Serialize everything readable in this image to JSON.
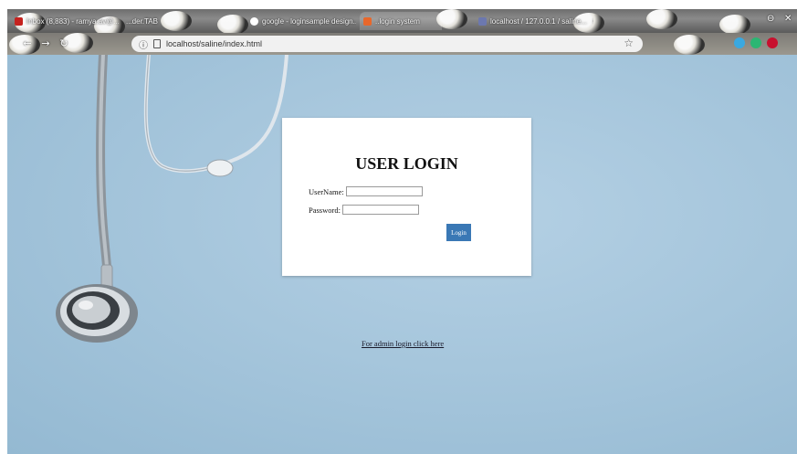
{
  "browser": {
    "tabs": [
      {
        "label": "Inbox (8,883) - ramya.av@..."
      },
      {
        "label": "...der.TAB"
      },
      {
        "label": "google - loginsample design..."
      },
      {
        "label": "..login system"
      },
      {
        "label": "localhost / 127.0.0.1 / saline..."
      }
    ],
    "window_controls": {
      "minimize": "⊖",
      "close": "✕"
    },
    "nav": {
      "back": "←",
      "forward": "→",
      "reload": "↻"
    },
    "url": "localhost/saline/index.html",
    "url_info_icon": "ⓘ",
    "bookmark_icon": "☆",
    "extension_colors": [
      "#3aa8e0",
      "#2bb673",
      "#c8102e"
    ]
  },
  "login": {
    "title": "USER LOGIN",
    "username_label": "UserName:",
    "username_value": "",
    "password_label": "Password:",
    "password_value": "",
    "button_label": "Login",
    "button_color": "#3a78b5"
  },
  "admin_link": "For admin login click here"
}
